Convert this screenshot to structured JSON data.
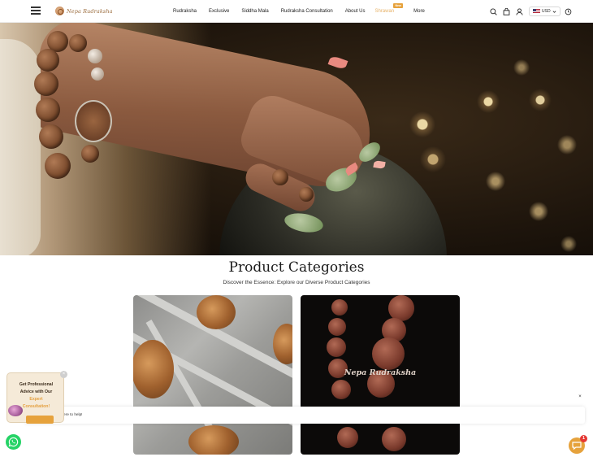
{
  "header": {
    "logo_text": "Nepa Rudraksha",
    "nav": [
      {
        "label": "Rudraksha"
      },
      {
        "label": "Exclusive"
      },
      {
        "label": "Siddha Mala"
      },
      {
        "label": "Rudraksha Consultation"
      },
      {
        "label": "About Us"
      },
      {
        "label": "Shrawan",
        "badge": "New",
        "color": "#e7b36a"
      },
      {
        "label": "More"
      }
    ],
    "currency": "USD",
    "icons": [
      "menu-icon",
      "search-icon",
      "bag-icon",
      "user-icon",
      "chevron-down-icon",
      "clock-icon"
    ]
  },
  "categories": {
    "title": "Product Categories",
    "subtitle": "Discover the Essence: Explore our Diverse Product Categories",
    "card_brand": "Nepa Rudraksha"
  },
  "consult": {
    "line1": "Get Professional",
    "line2": "Advice with Our",
    "line3": "Expert",
    "line4": "Consultation!",
    "close": "×"
  },
  "chat": {
    "welcome": "Welcome, we are here to help!",
    "close": "×",
    "unread": "1"
  },
  "colors": {
    "accent": "#e6a23c",
    "whatsapp": "#25d366",
    "badge": "#e53935"
  }
}
